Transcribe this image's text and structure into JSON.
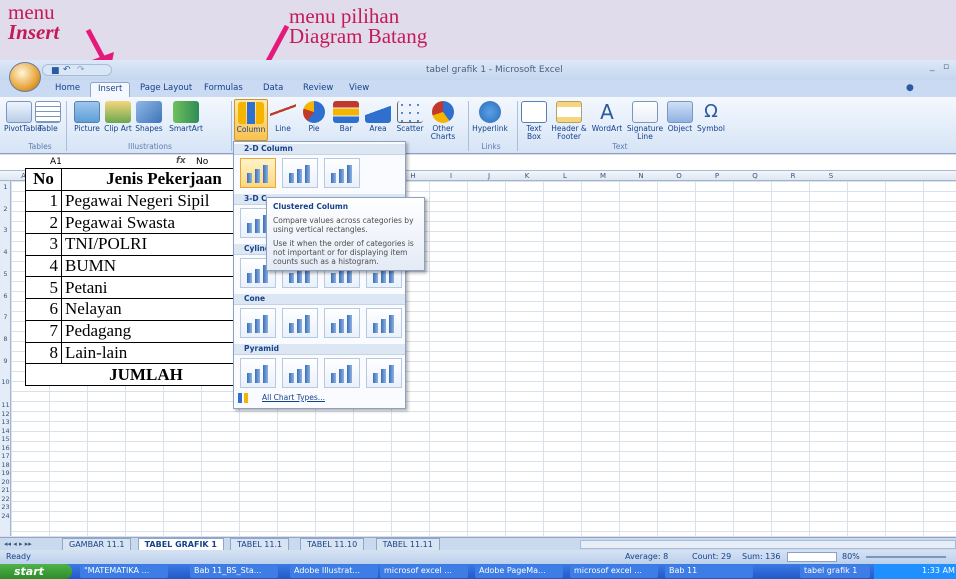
{
  "annotations": {
    "menu1_line1": "menu",
    "menu1_line2": "Insert",
    "menu2_line1": "menu  pilihan",
    "menu2_line2": "Diagram Batang",
    "arrow_color": "#e5197a"
  },
  "window": {
    "title": "tabel grafik 1 - Microsoft Excel",
    "win_controls": [
      "_",
      "▫",
      "×"
    ]
  },
  "tabs": [
    "Home",
    "Insert",
    "Page Layout",
    "Formulas",
    "Data",
    "Review",
    "View"
  ],
  "active_tab": "Insert",
  "ribbon": {
    "buttons": [
      {
        "label": "PivotTable",
        "icon": "pivottable-icon"
      },
      {
        "label": "Table",
        "icon": "table-icon"
      },
      {
        "label": "Picture",
        "icon": "picture-icon"
      },
      {
        "label": "Clip Art",
        "icon": "clip-art-icon"
      },
      {
        "label": "Shapes",
        "icon": "shapes-icon"
      },
      {
        "label": "SmartArt",
        "icon": "smartart-icon"
      },
      {
        "label": "Column",
        "icon": "column-chart-icon"
      },
      {
        "label": "Line",
        "icon": "line-chart-icon"
      },
      {
        "label": "Pie",
        "icon": "pie-chart-icon"
      },
      {
        "label": "Bar",
        "icon": "bar-chart-icon"
      },
      {
        "label": "Area",
        "icon": "area-chart-icon"
      },
      {
        "label": "Scatter",
        "icon": "scatter-chart-icon"
      },
      {
        "label": "Other Charts",
        "icon": "other-charts-icon"
      },
      {
        "label": "Hyperlink",
        "icon": "hyperlink-icon"
      },
      {
        "label": "Text Box",
        "icon": "text-box-icon"
      },
      {
        "label": "Header & Footer",
        "icon": "header-footer-icon"
      },
      {
        "label": "WordArt",
        "icon": "wordart-icon"
      },
      {
        "label": "Signature Line",
        "icon": "signature-line-icon"
      },
      {
        "label": "Object",
        "icon": "object-icon"
      },
      {
        "label": "Symbol",
        "icon": "symbol-icon"
      }
    ],
    "groups": [
      "Tables",
      "Illustrations",
      "Links",
      "Text"
    ]
  },
  "formula_bar": {
    "name_box": "A1",
    "fx": "fx",
    "value": "No"
  },
  "columns": [
    "A",
    "B",
    "C",
    "D",
    "E",
    "F",
    "G",
    "H",
    "I",
    "J",
    "K",
    "L",
    "M",
    "N",
    "O",
    "P",
    "Q",
    "R",
    "S"
  ],
  "rows": [
    "1",
    "2",
    "3",
    "4",
    "5",
    "6",
    "7",
    "8",
    "9",
    "10",
    "11",
    "12",
    "13",
    "14",
    "15",
    "16",
    "17",
    "18",
    "19",
    "20",
    "21",
    "22",
    "23",
    "24"
  ],
  "table": {
    "header": [
      "No",
      "Jenis Pekerjaan"
    ],
    "rows": [
      [
        "1",
        "Pegawai Negeri Sipil"
      ],
      [
        "2",
        "Pegawai Swasta"
      ],
      [
        "3",
        "TNI/POLRI"
      ],
      [
        "4",
        "BUMN"
      ],
      [
        "5",
        "Petani"
      ],
      [
        "6",
        "Nelayan"
      ],
      [
        "7",
        "Pedagang"
      ],
      [
        "8",
        "Lain-lain"
      ]
    ],
    "footer": "JUMLAH"
  },
  "dropdown": {
    "sections": [
      "2-D Column",
      "3-D C",
      "Cylind",
      "Cone",
      "Pyramid"
    ],
    "all_chart_types": "All Chart Types..."
  },
  "tooltip": {
    "title": "Clustered Column",
    "line1": "Compare values across categories by using vertical rectangles.",
    "line2": "Use it when the order of categories is not important or for displaying item counts such as a histogram."
  },
  "sheet_tabs": [
    "GAMBAR 11.1",
    "TABEL GRAFIK 1",
    "TABEL 11.1",
    "TABEL 11.10",
    "TABEL 11.11"
  ],
  "active_sheet": "TABEL GRAFIK 1",
  "status": {
    "ready": "Ready",
    "average": "Average: 8",
    "count": "Count: 29",
    "sum": "Sum: 136",
    "zoom": "80%"
  },
  "taskbar": {
    "start": "start",
    "items": [
      "\"MATEMATIKA ...",
      "Bab 11_BS_Sta...",
      "Adobe Illustrat...",
      "microsof excel ...",
      "Adobe PageMa...",
      "microsof excel ...",
      "Bab 11",
      "tabel grafik 1"
    ],
    "time": "1:33 AM"
  }
}
